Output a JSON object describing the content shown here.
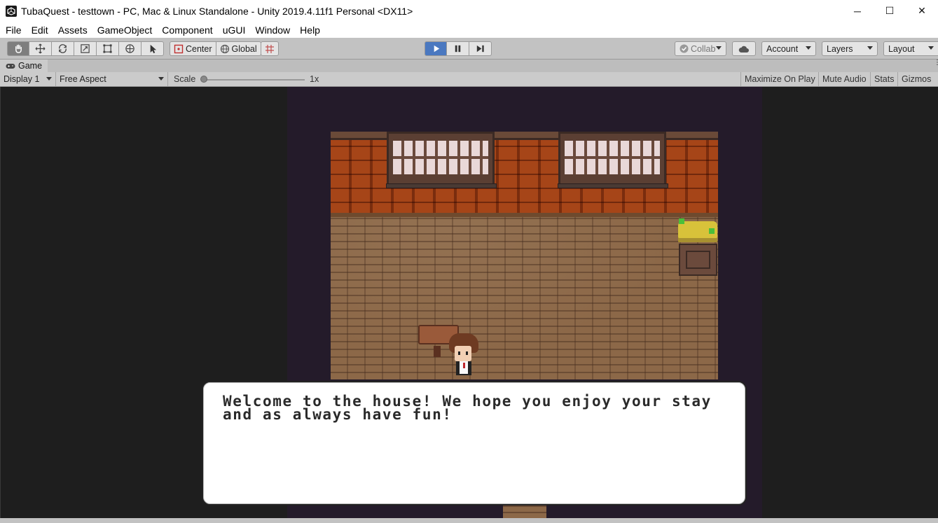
{
  "window": {
    "title": "TubaQuest - testtown - PC, Mac & Linux Standalone - Unity 2019.4.11f1 Personal <DX11>",
    "controls": {
      "minimize": "─",
      "maximize": "☐",
      "close": "✕"
    }
  },
  "menu": {
    "items": [
      "File",
      "Edit",
      "Assets",
      "GameObject",
      "Component",
      "uGUI",
      "Window",
      "Help"
    ]
  },
  "toolbar": {
    "transform_tools": [
      "hand-tool",
      "move-tool",
      "rotate-tool",
      "scale-tool",
      "rect-tool",
      "transform-tool",
      "custom-tool"
    ],
    "pivot_label": "Center",
    "space_label": "Global",
    "collab_label": "Collab",
    "account_label": "Account",
    "layers_label": "Layers",
    "layout_label": "Layout",
    "play_state": "playing"
  },
  "game_tab": {
    "label": "Game"
  },
  "game_toolbar": {
    "display": "Display 1",
    "aspect": "Free Aspect",
    "scale_label": "Scale",
    "scale_value": "1x",
    "maximize_on_play": "Maximize On Play",
    "mute_audio": "Mute Audio",
    "stats": "Stats",
    "gizmos": "Gizmos"
  },
  "game": {
    "dialog_text": "Welcome to the house! We hope you enjoy your stay and as always have fun!"
  },
  "colors": {
    "editor_bg": "#c2c2c2",
    "play_accent": "#4a78c0",
    "game_bg": "#241b2a"
  }
}
